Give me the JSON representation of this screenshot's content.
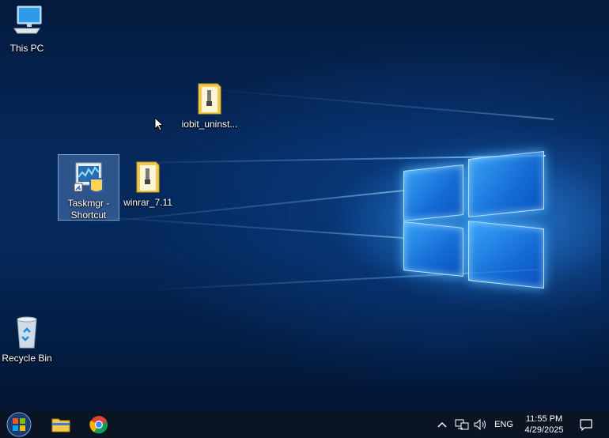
{
  "desktop": {
    "icons": [
      {
        "label": "This PC"
      },
      {
        "label": "iobit_uninst..."
      },
      {
        "label": "Taskmgr -\nShortcut"
      },
      {
        "label": "winrar_7.11"
      },
      {
        "label": "Recycle Bin"
      }
    ]
  },
  "taskbar": {
    "pinned": [
      "start-button",
      "file-explorer",
      "chrome"
    ],
    "tray": {
      "language": "ENG",
      "time": "11:55 PM",
      "date": "4/29/2025"
    }
  },
  "colors": {
    "taskbar_bg": "#0b1422",
    "selection": "#78aae6",
    "folder": "#f2c94c"
  }
}
